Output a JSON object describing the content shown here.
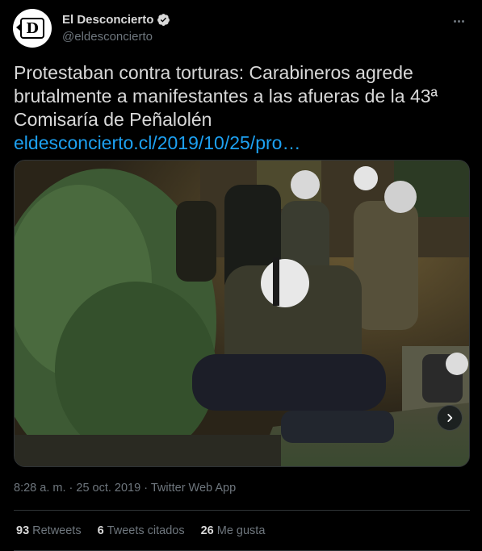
{
  "author": {
    "display_name": "El Desconcierto",
    "handle": "@eldesconcierto",
    "avatar_glyph": "D",
    "verified": true,
    "verified_icon": "verified-badge-icon"
  },
  "menu": {
    "icon": "more-horizontal-icon"
  },
  "tweet": {
    "text": "Protestaban contra torturas: Carabineros agrede brutalmente a manifestantes a las afueras de la 43ª Comisaría de Peñalolén",
    "link": "eldesconcierto.cl/2019/10/25/pro…"
  },
  "media": {
    "kind": "photo",
    "next_icon": "chevron-right-icon"
  },
  "meta": {
    "time": "8:28 a. m.",
    "separator1": " · ",
    "date": "25 oct. 2019",
    "separator2": " · ",
    "source": "Twitter Web App"
  },
  "stats": [
    {
      "count": "93",
      "label": "Retweets"
    },
    {
      "count": "6",
      "label": "Tweets citados"
    },
    {
      "count": "26",
      "label": "Me gusta"
    }
  ],
  "colors": {
    "background": "#000000",
    "text": "#d9d9d9",
    "secondary": "#6e767d",
    "link": "#1da1f2",
    "divider": "#2f3336",
    "verified": "#d9d9d9"
  }
}
